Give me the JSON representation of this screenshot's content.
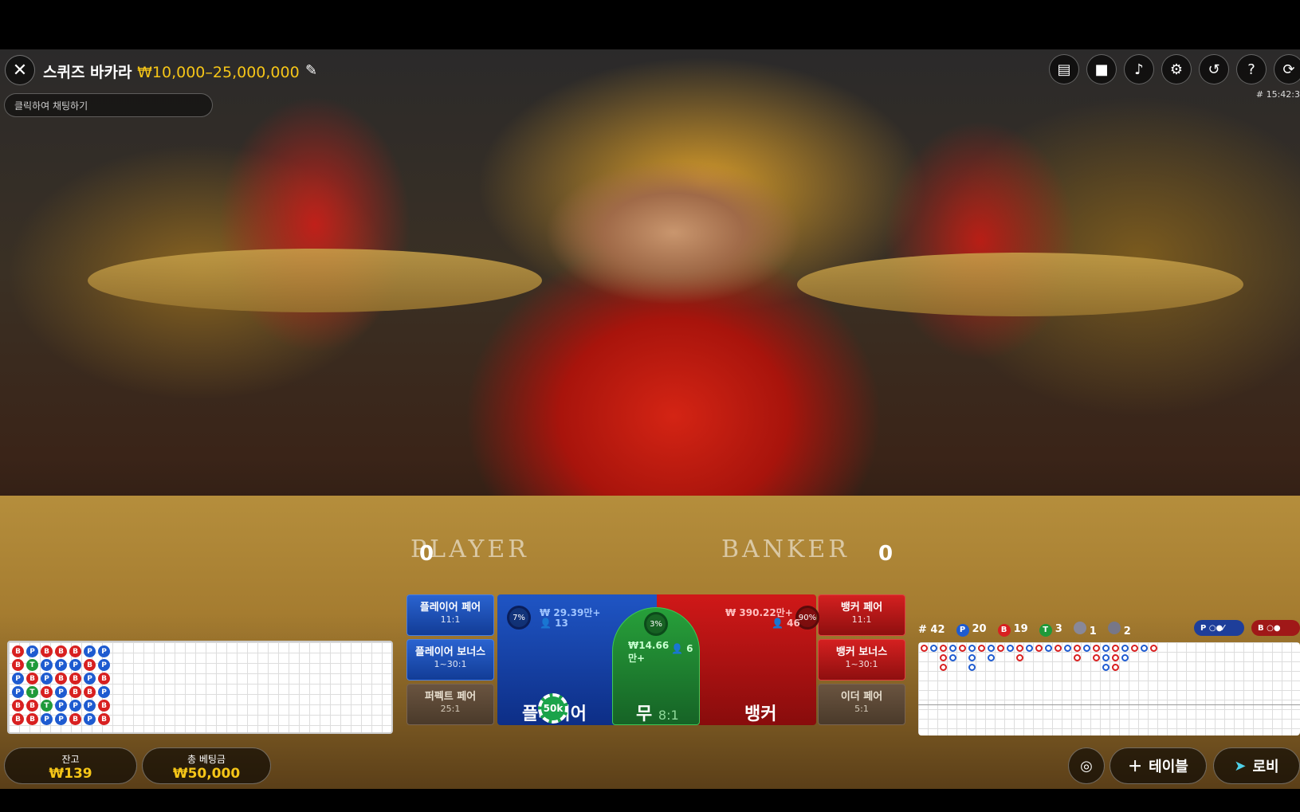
{
  "header": {
    "title": "스퀴즈 바카라",
    "limits": "₩10,000–25,000,000",
    "chat_placeholder": "클릭하여 채팅하기",
    "game_id": "# 15:42:3",
    "icons": [
      "chat-icon",
      "video-icon",
      "volume-icon",
      "settings-icon",
      "history-icon",
      "help-icon",
      "fullscreen-icon"
    ]
  },
  "table": {
    "player_felt": "PLAYER",
    "banker_felt": "BANKER",
    "player_score": "0",
    "banker_score": "0"
  },
  "bets": {
    "player_pair": {
      "label": "플레이어 페어",
      "odds": "11:1"
    },
    "player_bonus": {
      "label": "플레이어 보너스",
      "odds": "1~30:1"
    },
    "perfect_pair": {
      "label": "퍼펙트 페어",
      "odds": "25:1"
    },
    "banker_pair": {
      "label": "뱅커 페어",
      "odds": "11:1"
    },
    "banker_bonus": {
      "label": "뱅커 보너스",
      "odds": "1~30:1"
    },
    "either_pair": {
      "label": "이더 페어",
      "odds": "5:1"
    },
    "player": {
      "label": "플레이어",
      "amount": "₩ 29.39만+",
      "players": "13",
      "percent": "7%"
    },
    "tie": {
      "label": "무",
      "odds": "8:1",
      "amount": "₩14.66만+",
      "players": "6",
      "percent": "3%"
    },
    "banker": {
      "label": "뱅커",
      "amount": "₩ 390.22만+",
      "players": "46",
      "percent": "90%"
    },
    "chip": "50k"
  },
  "roadmap": {
    "round": "# 42",
    "player_wins": "20",
    "banker_wins": "19",
    "ties": "3",
    "player_pairs": "1",
    "banker_pairs": "2",
    "p_label": "P",
    "b_label": "B",
    "t_label": "T",
    "predict_player": "P",
    "predict_banker": "B",
    "bead_road": [
      [
        "B",
        "P",
        "B",
        "B",
        "B",
        "P",
        "P"
      ],
      [
        "B",
        "T",
        "P",
        "P",
        "P",
        "B",
        "P"
      ],
      [
        "P",
        "B",
        "P",
        "B",
        "B",
        "P",
        "B"
      ],
      [
        "P",
        "T",
        "B",
        "P",
        "B",
        "B",
        "P"
      ],
      [
        "B",
        "B",
        "T",
        "P",
        "P",
        "P",
        "B"
      ],
      [
        "B",
        "B",
        "P",
        "P",
        "B",
        "P",
        "B"
      ]
    ],
    "colors": {
      "player": "#1e5bd0",
      "banker": "#d82020",
      "tie": "#1f9a3a"
    }
  },
  "footer": {
    "balance_label": "잔고",
    "balance": "₩139",
    "total_bet_label": "총 베팅금",
    "total_bet": "₩50,000",
    "table_btn": "테이블",
    "lobby_btn": "로비"
  }
}
